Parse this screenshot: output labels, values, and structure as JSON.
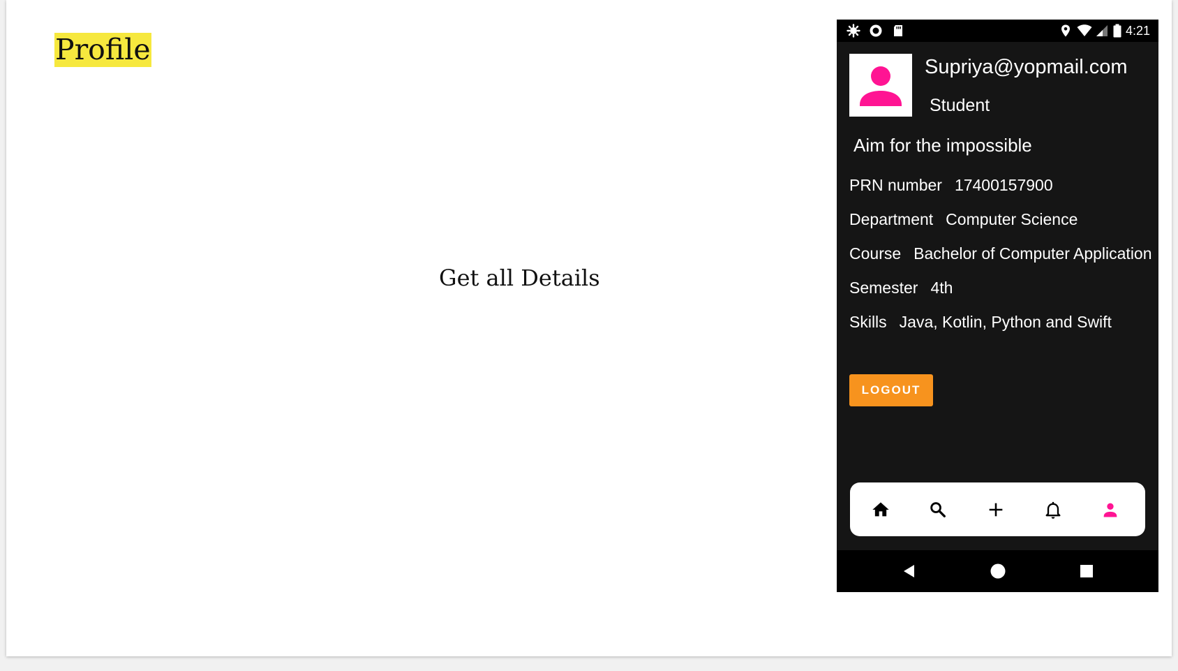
{
  "slide": {
    "title": "Profile",
    "center_text": "Get all Details"
  },
  "status_bar": {
    "time": "4:21",
    "icons": [
      "settings-icon",
      "record-icon",
      "sd-card-icon",
      "location-icon",
      "wifi-icon",
      "signal-icon",
      "battery-icon"
    ]
  },
  "profile": {
    "email": "Supriya@yopmail.com",
    "role": "Student",
    "motto": "Aim for the impossible",
    "avatar_icon": "person-icon",
    "details": [
      {
        "label": "PRN number",
        "value": "17400157900"
      },
      {
        "label": "Department",
        "value": "Computer Science"
      },
      {
        "label": "Course",
        "value": "Bachelor of Computer Application"
      },
      {
        "label": "Semester",
        "value": "4th"
      },
      {
        "label": "Skills",
        "value": "Java, Kotlin, Python and Swift"
      }
    ],
    "logout_label": "LOGOUT"
  },
  "bottom_nav": {
    "items": [
      "home-icon",
      "search-icon",
      "add-icon",
      "bell-icon",
      "person-icon"
    ],
    "active": "person-icon"
  },
  "system_nav": {
    "items": [
      "back-icon",
      "home-circle-icon",
      "recents-icon"
    ]
  },
  "colors": {
    "accent": "#ff1493",
    "button": "#f7931e",
    "title_highlight": "#f6e83e",
    "phone_background": "#151515"
  }
}
